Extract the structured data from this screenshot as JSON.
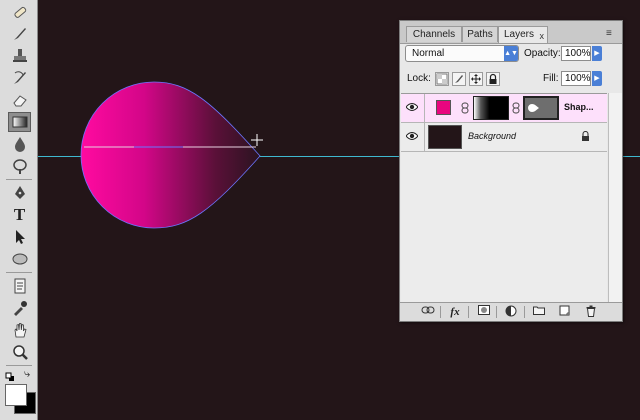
{
  "layers_panel": {
    "tabs": [
      {
        "label": "Channels",
        "active": false
      },
      {
        "label": "Paths",
        "active": false
      },
      {
        "label": "Layers",
        "active": true
      }
    ],
    "close_glyph": "x",
    "menu_glyph": "≡",
    "blend_mode": "Normal",
    "opacity_label": "Opacity:",
    "opacity_value": "100%",
    "lock_label": "Lock:",
    "fill_label": "Fill:",
    "fill_value": "100%",
    "layers": [
      {
        "name": "Shap...",
        "type": "shape",
        "fill_color": "#e8067f",
        "selected": true,
        "visible": true
      },
      {
        "name": "Background",
        "type": "background",
        "fill_color": "#231518",
        "selected": false,
        "visible": true,
        "locked": true
      }
    ],
    "footer_icons": [
      "link-layers-icon",
      "fx-icon",
      "add-mask-icon",
      "adjustment-layer-icon",
      "new-group-icon",
      "new-layer-icon",
      "trash-icon"
    ],
    "fx_label": "fx"
  },
  "canvas": {
    "background_color": "#231518",
    "guide_color": "#3fb8cf",
    "shape_gradient": [
      "#ff0aa0",
      "#2a1420"
    ]
  },
  "toolbar": {
    "tools": [
      "healing-brush",
      "brush",
      "clone-stamp",
      "history-brush",
      "eraser",
      "gradient",
      "blur",
      "dodge",
      "pen",
      "type",
      "path-selection",
      "ellipse",
      "notes",
      "eyedropper",
      "hand",
      "zoom"
    ],
    "active_tool": "gradient",
    "type_glyph": "T",
    "foreground_color": "#ffffff",
    "background_color": "#000000"
  }
}
